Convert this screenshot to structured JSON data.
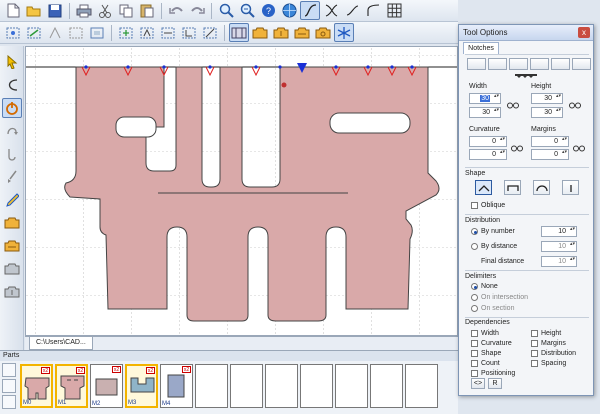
{
  "toolbar1": {
    "icons": [
      "new-document-icon",
      "open-folder-icon",
      "save-icon",
      "print-icon",
      "cut-icon",
      "copy-icon",
      "paste-icon",
      "undo-icon",
      "redo-icon",
      "zoom-in-icon",
      "zoom-out-icon",
      "help-icon",
      "globe-icon",
      "curve-s-icon",
      "curve-x-icon",
      "curve-flat-icon",
      "curve-angle-icon",
      "grid-icon"
    ]
  },
  "toolbar2": {
    "icons": [
      "nodes-move-icon",
      "nodes-scale-icon",
      "nodes-rotate-icon",
      "nodes-mirror-icon",
      "nodes-align-icon",
      "nodes-grid-icon",
      "nodes-join-icon",
      "nodes-split-icon",
      "nodes-weld-icon",
      "nodes-cut-icon",
      "film-icon",
      "pattern-1-icon",
      "pattern-2-icon",
      "pattern-3-icon",
      "pattern-4-icon",
      "snowflake-icon"
    ]
  },
  "sidebar": {
    "icons": [
      "pointer-icon",
      "curve-tool-icon",
      "power-icon",
      "rotate-tool-icon",
      "rotate-alt-icon",
      "brush-icon",
      "pencil-icon",
      "piece-1-icon",
      "piece-2-icon",
      "piece-3-icon",
      "piece-4-icon"
    ]
  },
  "document_tab": {
    "label": "C:\\Users\\CAD..."
  },
  "parts": {
    "title": "Parts",
    "items": [
      {
        "label": "M0",
        "qty": "x2"
      },
      {
        "label": "M1",
        "qty": "x2"
      },
      {
        "label": "M2",
        "qty": "x2"
      },
      {
        "label": "M3",
        "qty": "x2"
      },
      {
        "label": "M4",
        "qty": "x2"
      }
    ]
  },
  "panel": {
    "title": "Tool Options",
    "tab": "Notches",
    "width_label": "Width",
    "width_value": "30",
    "width_value2": "30",
    "height_label": "Height",
    "height_value": "30",
    "height_value2": "30",
    "curvature_label": "Curvature",
    "curvature_value": "0",
    "curvature_value2": "0",
    "margins_label": "Margins",
    "margins_value": "0",
    "margins_value2": "0",
    "shape_label": "Shape",
    "oblique_label": "Oblique",
    "distribution_label": "Distribution",
    "by_number_label": "By number",
    "by_number_value": "10",
    "by_distance_label": "By distance",
    "by_distance_value": "10",
    "final_distance_label": "Final distance",
    "final_distance_value": "10",
    "delimiters_label": "Delimiters",
    "delim_none": "None",
    "delim_intersection": "On intersection",
    "delim_section": "On section",
    "dependencies_label": "Dependencies",
    "dep_width": "Width",
    "dep_height": "Height",
    "dep_curvature": "Curvature",
    "dep_margins": "Margins",
    "dep_shape": "Shape",
    "dep_distribution": "Distribution",
    "dep_count": "Count",
    "dep_spacing": "Spacing",
    "dep_positioning": "Positioning",
    "bottom_btn1": "<>",
    "bottom_btn2": "R",
    "close": "x"
  },
  "colors": {
    "piece_fill": "#d9a9a9",
    "piece_stroke": "#444444",
    "notch": "#e02020",
    "selected_notch": "#1a2fd6"
  }
}
